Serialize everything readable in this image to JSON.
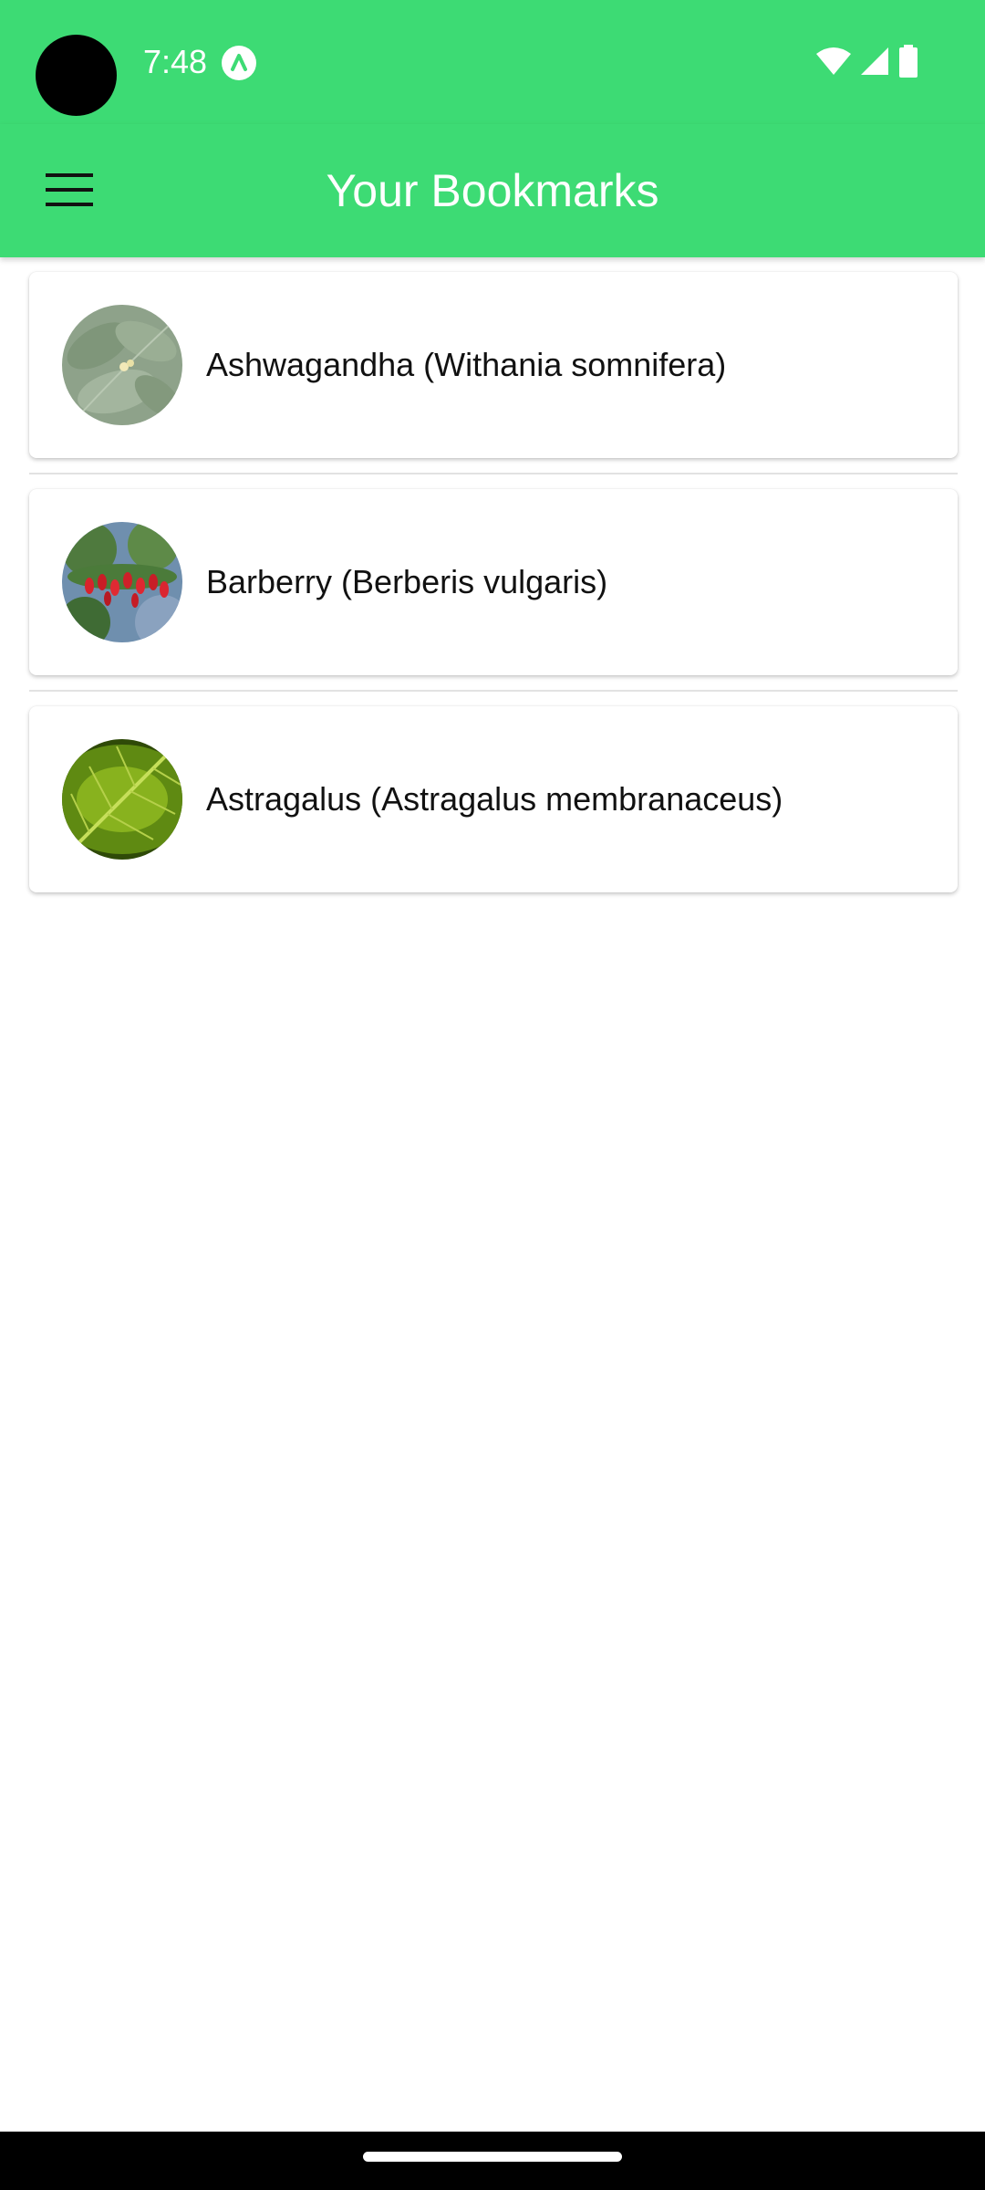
{
  "status_bar": {
    "time": "7:48",
    "icons": [
      "app-notification-icon",
      "wifi-icon",
      "cell-signal-icon",
      "battery-icon"
    ]
  },
  "app_bar": {
    "title": "Your Bookmarks",
    "menu_icon": "hamburger-menu-icon",
    "color": "#3ddb74"
  },
  "bookmarks": [
    {
      "name": "Ashwagandha (Withania somnifera)",
      "thumbnail": "ashwagandha-leaves"
    },
    {
      "name": "Barberry (Berberis vulgaris)",
      "thumbnail": "barberry-red-berries"
    },
    {
      "name": "Astragalus (Astragalus membranaceus)",
      "thumbnail": "astragalus-green-leaf"
    }
  ]
}
